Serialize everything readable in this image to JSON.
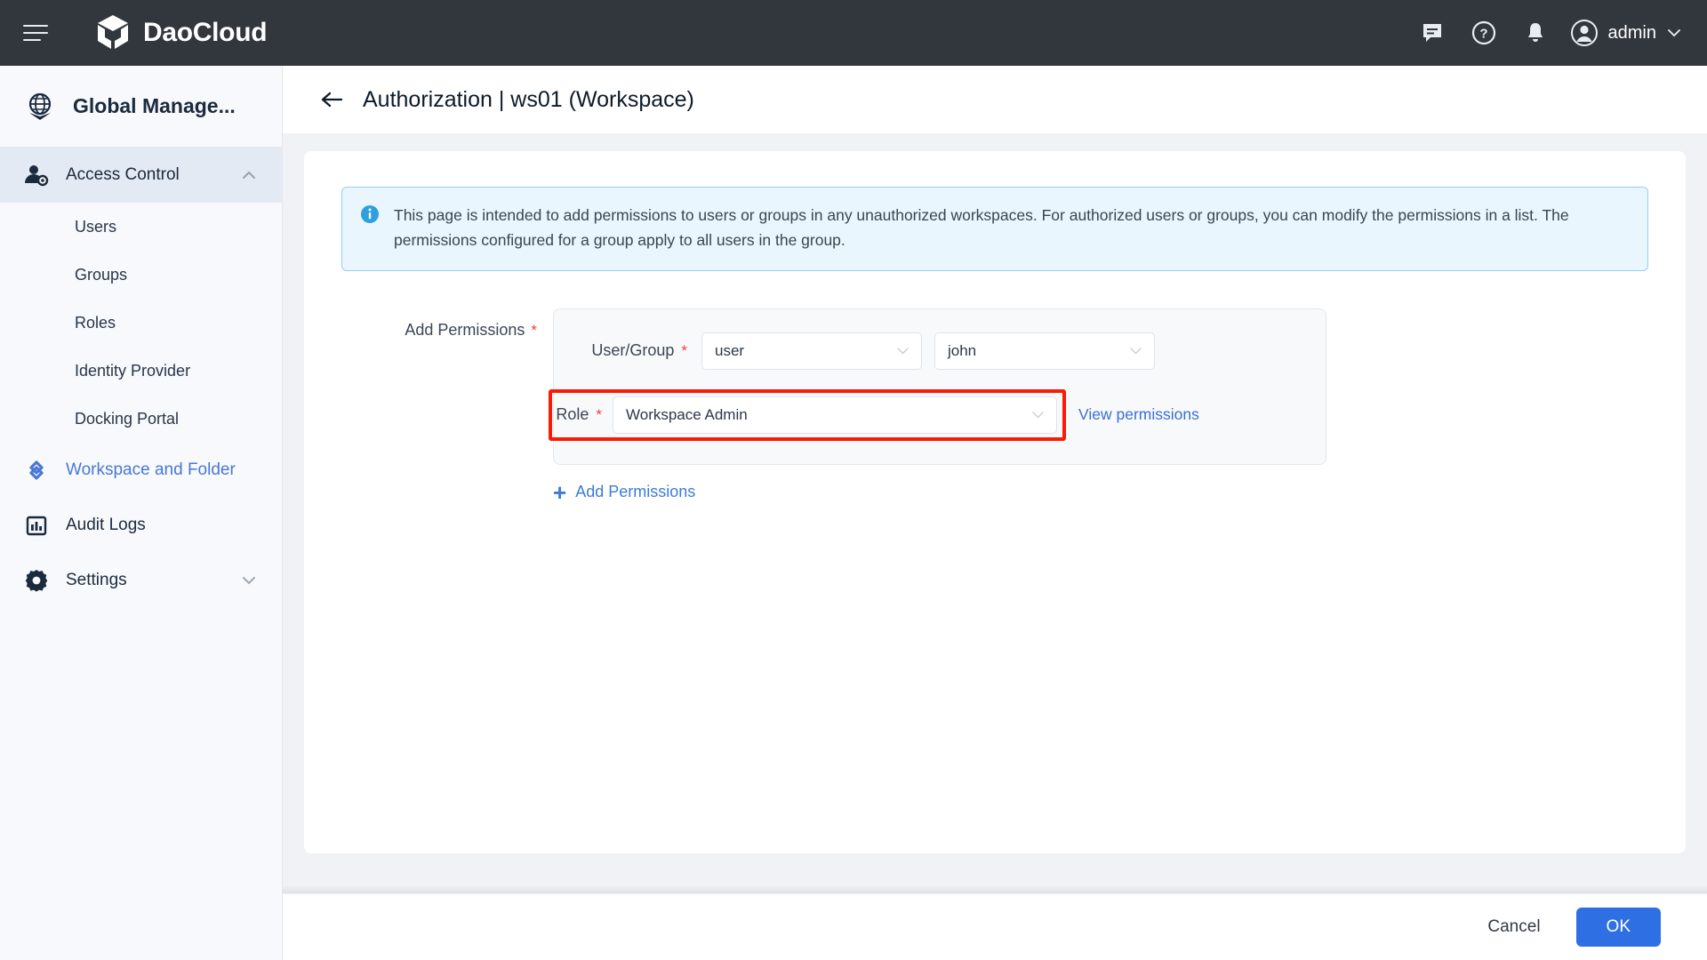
{
  "topbar": {
    "menu_icon": "hamburger-icon",
    "brand": "DaoCloud",
    "icons": [
      "chat-icon",
      "help-icon",
      "bell-icon"
    ],
    "user": "admin",
    "caret": "chevron-down-icon"
  },
  "sidebar": {
    "header": {
      "icon": "globe-icon",
      "title": "Global Manage..."
    },
    "groups": [
      {
        "label": "Access Control",
        "icon": "user-gear-icon",
        "active": true,
        "chevron": "chevron-up-icon"
      }
    ],
    "sub_items": [
      "Users",
      "Groups",
      "Roles",
      "Identity Provider",
      "Docking Portal"
    ],
    "workspace": {
      "label": "Workspace and Folder",
      "icon": "workspace-icon"
    },
    "audit": {
      "label": "Audit Logs",
      "icon": "chart-icon"
    },
    "settings": {
      "label": "Settings",
      "icon": "gear-icon",
      "chevron": "chevron-down-icon"
    }
  },
  "page": {
    "back_icon": "back-arrow-icon",
    "title": "Authorization | ws01 (Workspace)"
  },
  "banner": {
    "icon": "info-icon",
    "text": "This page is intended to add permissions to users or groups in any unauthorized workspaces. For authorized users or groups, you can modify the permissions in a list. The permissions configured for a group apply to all users in the group."
  },
  "form": {
    "section_label": "Add Permissions",
    "required_mark": "*",
    "user_group_label": "User/Group",
    "user_group_type_value": "user",
    "user_group_name_value": "john",
    "role_label": "Role",
    "role_value": "Workspace Admin",
    "view_permissions_link": "View permissions",
    "add_permissions_link": "Add Permissions",
    "add_icon": "plus-icon"
  },
  "footer": {
    "cancel_label": "Cancel",
    "ok_label": "OK"
  },
  "colors": {
    "topbar_bg": "#32373e",
    "accent_blue": "#2f6fe4",
    "link_blue": "#3b7bdb",
    "highlight_red": "#fc1a05",
    "required_red": "#e8443a",
    "banner_bg": "#eaf6fd",
    "banner_border": "#93cff0",
    "sidebar_bg": "#f7f9fc",
    "sidebar_active_bg": "#e4eaf3",
    "content_bg": "#f0f2f5"
  }
}
